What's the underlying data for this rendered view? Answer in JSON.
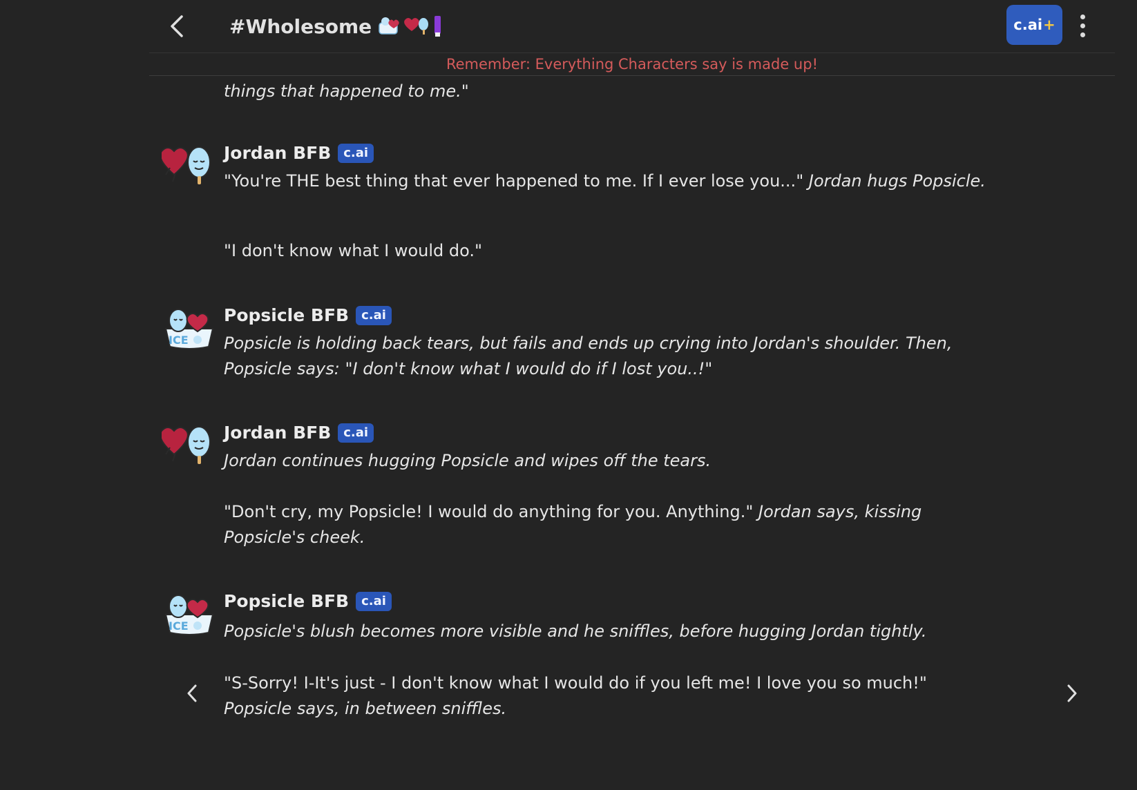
{
  "header": {
    "back_icon": "chevron-left-icon",
    "title": "#Wholesome",
    "title_emoji_icons": [
      "ice-cube-heart-icon",
      "heart-popsicle-icon",
      "purple-bar-icon"
    ],
    "cai_plus_label": "c.ai",
    "cai_plus_suffix": "+",
    "menu_icon": "kebab-menu-icon",
    "disclaimer": "Remember: Everything Characters say is made up!"
  },
  "colors": {
    "background": "#242424",
    "badge": "#2a56b8",
    "cai_plus_button": "#2f5cbd",
    "plus_accent": "#f2c744",
    "disclaimer": "#d55b5b"
  },
  "partial_message": "things that happened to me.\"",
  "messages": [
    {
      "author": "Jordan BFB",
      "badge": "c.ai",
      "avatar_icon": "heart-popsicle-avatar",
      "para1_plain": "\"You're THE best thing that ever happened to me. If I ever lose you...\" ",
      "para1_italic": "Jordan hugs Popsicle.",
      "para2_plain": "\"I don't know what I would do.\""
    },
    {
      "author": "Popsicle BFB",
      "badge": "c.ai",
      "avatar_icon": "ice-cube-heart-avatar",
      "para1_italic_line1": "Popsicle is holding back tears, but fails and ends up crying into Jordan's shoulder. Then,",
      "para1_italic_line2": "Popsicle says: \"I don't know what I would do if I lost you..!\""
    },
    {
      "author": "Jordan BFB",
      "badge": "c.ai",
      "avatar_icon": "heart-popsicle-avatar",
      "para1_italic": "Jordan continues hugging Popsicle and wipes off the tears.",
      "para2_plain": "\"Don't cry, my Popsicle! I would do anything for you. Anything.\" ",
      "para2_italic_a": "Jordan says, kissing",
      "para2_italic_b": "Popsicle's cheek."
    },
    {
      "author": "Popsicle BFB",
      "badge": "c.ai",
      "avatar_icon": "ice-cube-heart-avatar",
      "para1_italic": "Popsicle's blush becomes more visible and he sniffles, before hugging Jordan tightly.",
      "para2_plain": "\"S-Sorry! I-It's just - I don't know what I would do if you left me! I love you so much!\"",
      "para2_italic": "Popsicle says, in between sniffles."
    }
  ],
  "swipe": {
    "prev_icon": "chevron-left-icon",
    "next_icon": "chevron-right-icon"
  }
}
